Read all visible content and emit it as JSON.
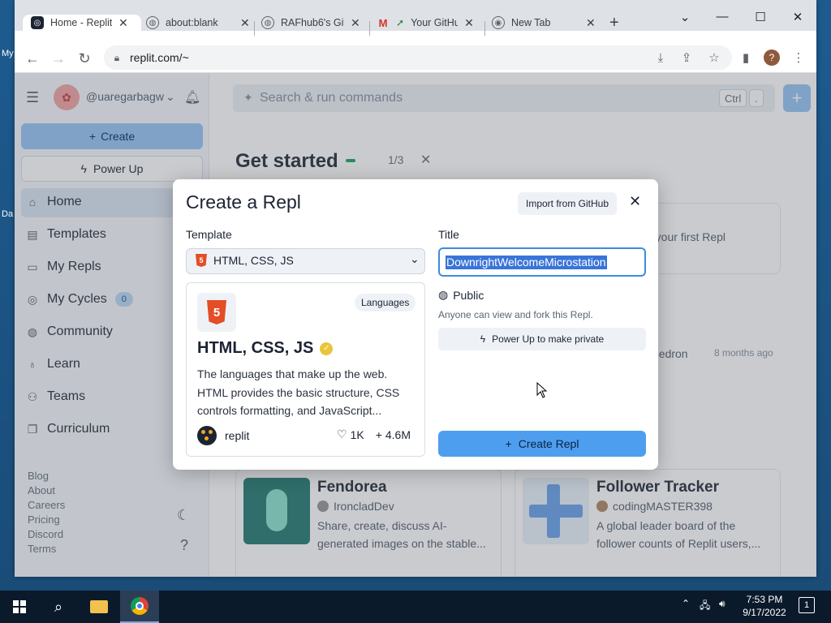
{
  "desktop": {
    "labels": [
      "My",
      "Da"
    ]
  },
  "browser": {
    "tabs": [
      {
        "title": "Home - Replit",
        "favicon": "replit-icon"
      },
      {
        "title": "about:blank",
        "favicon": "globe-icon"
      },
      {
        "title": "RAFhub6's Git",
        "favicon": "globe-icon"
      },
      {
        "title": "Your GitHu",
        "favicon": "gmail-icon"
      },
      {
        "title": "New Tab",
        "favicon": "chrome-icon"
      }
    ],
    "new_tab": "+",
    "url": "replit.com/~",
    "profile_initial": "?"
  },
  "sidebar": {
    "username": "@uaregarbagw",
    "create_label": "Create",
    "powerup_label": "Power Up",
    "items": [
      {
        "label": "Home",
        "icon": "home-icon"
      },
      {
        "label": "Templates",
        "icon": "templates-icon"
      },
      {
        "label": "My Repls",
        "icon": "folder-icon"
      },
      {
        "label": "My Cycles",
        "icon": "cycles-icon",
        "badge": "0"
      },
      {
        "label": "Community",
        "icon": "globe-icon"
      },
      {
        "label": "Learn",
        "icon": "learn-icon"
      },
      {
        "label": "Teams",
        "icon": "teams-icon"
      },
      {
        "label": "Curriculum",
        "icon": "book-icon"
      }
    ],
    "footer_links": [
      "Blog",
      "About",
      "Careers",
      "Pricing",
      "Discord",
      "Terms"
    ]
  },
  "main": {
    "search_placeholder": "Search & run commands",
    "kbd1": "Ctrl",
    "kbd2": ".",
    "get_started": "Get started",
    "progress": "1/3",
    "peek": {
      "first_repl": "e your first Repl",
      "author_fragment": "hedron",
      "time": "8 months ago"
    },
    "cards": [
      {
        "title": "Fendorea",
        "author": "IroncladDev",
        "desc_line1": "Share, create, discuss AI-",
        "desc_line2": "generated images on the stable..."
      },
      {
        "title": "Follower Tracker",
        "author": "codingMASTER398",
        "desc_line1": "A global leader board of the",
        "desc_line2": "follower counts of Replit users,..."
      }
    ]
  },
  "modal": {
    "title": "Create a Repl",
    "import_label": "Import from GitHub",
    "template_label": "Template",
    "title_label": "Title",
    "selected_template": "HTML, CSS, JS",
    "template_card": {
      "tag": "Languages",
      "name": "HTML, CSS, JS",
      "desc_line1": "The languages that make up the web.",
      "desc_line2": "HTML provides the basic structure, CSS",
      "desc_line3": "controls formatting, and JavaScript...",
      "author": "replit",
      "likes": "1K",
      "forks": "4.6M"
    },
    "title_value": "DownrightWelcomeMicrostation",
    "visibility": "Public",
    "visibility_desc": "Anyone can view and fork this Repl.",
    "powerup_private": "Power Up to make private",
    "create_button": "Create Repl"
  },
  "taskbar": {
    "time": "7:53 PM",
    "date": "9/17/2022",
    "notifications": "1"
  },
  "colors": {
    "accent": "#4e9ef0",
    "selection": "#3a74d8",
    "html5": "#e44d26"
  }
}
